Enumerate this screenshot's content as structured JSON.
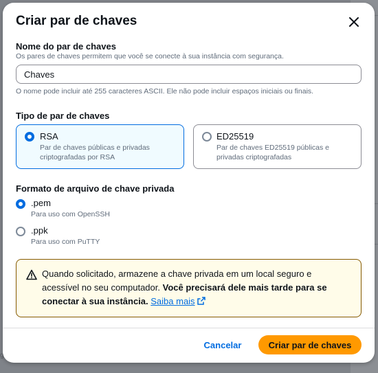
{
  "background": {
    "right_fragments": [
      "Nu",
      "ar",
      "R",
      "tr",
      "ar",
      "ar",
      "P",
      "ar"
    ],
    "left_fragment": "g"
  },
  "modal": {
    "title": "Criar par de chaves",
    "close_icon": "close-icon"
  },
  "key_name": {
    "label": "Nome do par de chaves",
    "description": "Os pares de chaves permitem que você se conecte à sua instância com segurança.",
    "value": "Chaves",
    "constraint": "O nome pode incluir até 255 caracteres ASCII. Ele não pode incluir espaços iniciais ou finais."
  },
  "key_type": {
    "label": "Tipo de par de chaves",
    "options": [
      {
        "title": "RSA",
        "description": "Par de chaves públicas e privadas criptografadas por RSA",
        "selected": true
      },
      {
        "title": "ED25519",
        "description": "Par de chaves ED25519 públicas e privadas criptografadas",
        "selected": false
      }
    ]
  },
  "file_format": {
    "label": "Formato de arquivo de chave privada",
    "options": [
      {
        "title": ".pem",
        "description": "Para uso com OpenSSH",
        "selected": true
      },
      {
        "title": ".ppk",
        "description": "Para uso com PuTTY",
        "selected": false
      }
    ]
  },
  "alert": {
    "icon": "warning-icon",
    "text_regular": "Quando solicitado, armazene a chave privada em um local seguro e acessível no seu computador. ",
    "text_bold": "Você precisará dele mais tarde para se conectar à sua instância.",
    "link_label": "Saiba mais",
    "link_icon": "external-link-icon"
  },
  "footer": {
    "cancel_label": "Cancelar",
    "create_label": "Criar par de chaves"
  },
  "colors": {
    "primary_blue": "#006ce0",
    "accent_orange": "#ff9900",
    "warning_border": "#855900",
    "warning_bg": "#fffce9"
  }
}
